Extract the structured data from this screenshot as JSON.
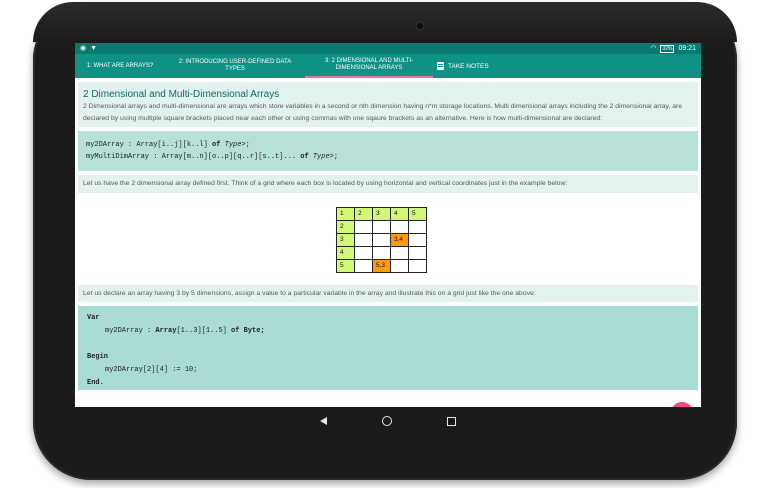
{
  "status_bar": {
    "left_icons": [
      "location-icon",
      "notification-icon"
    ],
    "battery": "32%",
    "time": "09:21"
  },
  "tabs": [
    {
      "label": "1: WHAT ARE ARRAYS?"
    },
    {
      "label": "2: INTRODUCING USER-DEFINED DATA TYPES"
    },
    {
      "label": "3: 2 DIMENSIONAL AND MULTI-DIMENSIONAL ARRAYS"
    },
    {
      "label": "TAKE NOTES"
    }
  ],
  "content": {
    "title": "2 Dimensional and Multi-Dimensional Arrays",
    "intro": "2 Dimensional arrays and multi-dimensional are arrays which store variables in a second or nth dimension having n*m storage locations. Multi dimensional arrays including the 2 dimensional array, are declared by using multiple square brackets placed near each other or using commas with one sqaure brackets as an alternative. Here is how multi-dimensional are declared:",
    "code1": {
      "line1_name": "my2DArray",
      "line1_rest": " : Array[i..j][k..l] ",
      "line1_of": "of",
      "line1_type": " Type",
      "line1_end": ">;",
      "line2_name": "myMultiDimArray",
      "line2_rest": " : Array[m..n][o..p][q..r][s..t]... ",
      "line2_of": "of",
      "line2_type": " Type",
      "line2_end": ">;"
    },
    "grid_intro": "Let us have the 2 dimensional array defined first. Think of a grid where each box is located by using horizontal and vertical coordinates just in the example below:",
    "grid": {
      "header": [
        "1",
        "2",
        "3",
        "4",
        "5"
      ],
      "rows": [
        "2",
        "3",
        "4",
        "5"
      ],
      "cell_3_4": "3,4",
      "cell_5_3": "5,3",
      "colors": {
        "header": "#d4f777",
        "highlight": "#ff9a0f"
      }
    },
    "declare_intro": "Let us declare an array having 3 by 5 dimensions, assign a value to a particular variable in the array and illustrate this on a grid just like the one above:",
    "code2": {
      "var": "Var",
      "decl_name": "my2DArray",
      "decl_rest": " : ",
      "decl_array": "Array",
      "decl_range": "[1..3][1..5] ",
      "decl_of": "of",
      "decl_type": " Byte;",
      "begin": "Begin",
      "assign_name": "my2DArray",
      "assign_rest": "[2][4] := 10;",
      "end": "End."
    }
  },
  "fab_icon": "pencil-icon",
  "nav": [
    "back-icon",
    "home-icon",
    "recent-apps-icon"
  ]
}
